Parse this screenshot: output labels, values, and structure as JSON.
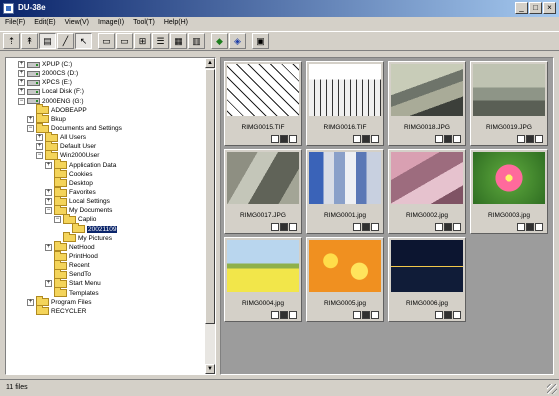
{
  "window": {
    "title": "DU-38e",
    "controls": [
      "_",
      "□",
      "×"
    ]
  },
  "menu": [
    "File(F)",
    "Edit(E)",
    "View(V)",
    "Image(I)",
    "Tool(T)",
    "Help(H)"
  ],
  "toolbar": [
    {
      "icon": "go-up-folder-icon",
      "glyph": "⇡"
    },
    {
      "icon": "go-up-icon",
      "glyph": "↟"
    },
    {
      "icon": "folder-view-icon",
      "glyph": "▤",
      "pressed": true
    },
    {
      "icon": "pen-icon",
      "glyph": "╱"
    },
    {
      "icon": "arrow-cursor-icon",
      "glyph": "↖",
      "pressed": true
    },
    {
      "sep": true
    },
    {
      "icon": "single-view-icon",
      "glyph": "▭"
    },
    {
      "icon": "double-view-icon",
      "glyph": "▭"
    },
    {
      "icon": "grid-view-icon",
      "glyph": "⊞"
    },
    {
      "icon": "list-view-icon",
      "glyph": "☰"
    },
    {
      "icon": "thumbnail-view-icon",
      "glyph": "▦"
    },
    {
      "icon": "detail-view-icon",
      "glyph": "▥"
    },
    {
      "sep": true
    },
    {
      "icon": "green-camera-icon",
      "glyph": "◆",
      "tone": "green"
    },
    {
      "icon": "image-tool-icon",
      "glyph": "◈",
      "tone": "blue"
    },
    {
      "sep": true
    },
    {
      "icon": "properties-icon",
      "glyph": "▣"
    }
  ],
  "tree": [
    {
      "indent": 2,
      "exp": "+",
      "icon": "drive",
      "label": "XPUP (C:)"
    },
    {
      "indent": 2,
      "exp": "+",
      "icon": "drive",
      "label": "2000CS (D:)"
    },
    {
      "indent": 2,
      "exp": "+",
      "icon": "drive",
      "label": "XPCS (E:)"
    },
    {
      "indent": 2,
      "exp": "+",
      "icon": "drive",
      "label": "Local Disk (F:)"
    },
    {
      "indent": 2,
      "exp": "−",
      "icon": "drive",
      "label": "2000ENG (G:)"
    },
    {
      "indent": 3,
      "exp": "",
      "icon": "folder",
      "label": "ADOBEAPP"
    },
    {
      "indent": 3,
      "exp": "+",
      "icon": "folder",
      "label": "Bkup"
    },
    {
      "indent": 3,
      "exp": "−",
      "icon": "folder",
      "label": "Documents and Settings"
    },
    {
      "indent": 4,
      "exp": "+",
      "icon": "folder",
      "label": "All Users"
    },
    {
      "indent": 4,
      "exp": "+",
      "icon": "folder",
      "label": "Default User"
    },
    {
      "indent": 4,
      "exp": "−",
      "icon": "folder",
      "label": "Win2000User"
    },
    {
      "indent": 5,
      "exp": "+",
      "icon": "folder",
      "label": "Application Data"
    },
    {
      "indent": 5,
      "exp": "",
      "icon": "folder",
      "label": "Cookies"
    },
    {
      "indent": 5,
      "exp": "",
      "icon": "folder",
      "label": "Desktop"
    },
    {
      "indent": 5,
      "exp": "+",
      "icon": "folder",
      "label": "Favorites"
    },
    {
      "indent": 5,
      "exp": "+",
      "icon": "folder",
      "label": "Local Settings"
    },
    {
      "indent": 5,
      "exp": "−",
      "icon": "folder",
      "label": "My Documents"
    },
    {
      "indent": 6,
      "exp": "−",
      "icon": "folder",
      "label": "Caplio"
    },
    {
      "indent": 7,
      "exp": "",
      "icon": "folder",
      "label": "20021109",
      "selected": true
    },
    {
      "indent": 6,
      "exp": "",
      "icon": "folder",
      "label": "My Pictures"
    },
    {
      "indent": 5,
      "exp": "+",
      "icon": "folder",
      "label": "NetHood"
    },
    {
      "indent": 5,
      "exp": "",
      "icon": "folder",
      "label": "PrintHood"
    },
    {
      "indent": 5,
      "exp": "",
      "icon": "folder",
      "label": "Recent"
    },
    {
      "indent": 5,
      "exp": "",
      "icon": "folder",
      "label": "SendTo"
    },
    {
      "indent": 5,
      "exp": "+",
      "icon": "folder",
      "label": "Start Menu"
    },
    {
      "indent": 5,
      "exp": "",
      "icon": "folder",
      "label": "Templates"
    },
    {
      "indent": 3,
      "exp": "+",
      "icon": "folder",
      "label": "Program Files"
    },
    {
      "indent": 3,
      "exp": "",
      "icon": "folder",
      "label": "RECYCLER"
    }
  ],
  "thumbnails": [
    {
      "name": "RIMG0015.TIF",
      "scene": "sketch"
    },
    {
      "name": "RIMG0016.TIF",
      "scene": "keyboard"
    },
    {
      "name": "RIMG0018.JPG",
      "scene": "office"
    },
    {
      "name": "RIMG0019.JPG",
      "scene": "office2"
    },
    {
      "name": "RIMG0017.JPG",
      "scene": "office3"
    },
    {
      "name": "RIMG0001.jpg",
      "scene": "building"
    },
    {
      "name": "RIMG0002.jpg",
      "scene": "pink-building"
    },
    {
      "name": "RIMG0003.jpg",
      "scene": "flower"
    },
    {
      "name": "RIMG0004.jpg",
      "scene": "field"
    },
    {
      "name": "RIMG0005.jpg",
      "scene": "orange-flowers"
    },
    {
      "name": "RIMG0006.jpg",
      "scene": "night-bridge"
    }
  ],
  "status": {
    "text": "11 files"
  }
}
